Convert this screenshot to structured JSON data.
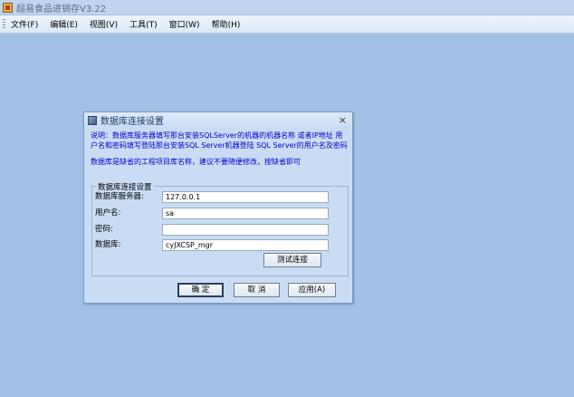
{
  "window": {
    "title": "超易食品进销存V3.22"
  },
  "menu": [
    "文件(F)",
    "编辑(E)",
    "视图(V)",
    "工具(T)",
    "窗口(W)",
    "帮助(H)"
  ],
  "dialog": {
    "title": "数据库连接设置",
    "close": "×",
    "description": "说明：数据库服务器填写那台安装SQLServer的机器的机器名称 或者IP地址 用户名和密码填写登陆那台安装SQL Server机器登陆 SQL Server的用户名及密码",
    "note": "数据库是缺省的工程项目库名称，建议不要随便修改，按缺省即可",
    "group_label": "数据库连接设置",
    "fields": {
      "server": {
        "label": "数据库服务器:",
        "value": "127.0.0.1"
      },
      "user": {
        "label": "用户名:",
        "value": "sa"
      },
      "password": {
        "label": "密码:",
        "value": ""
      },
      "database": {
        "label": "数据库:",
        "value": "cyJXCSP_mgr"
      }
    },
    "buttons": {
      "test": "测试连接",
      "ok": "确 定",
      "cancel": "取 消",
      "apply": "应用(A)"
    }
  },
  "colors": {
    "desktop": "#a3c0e6",
    "dialog": "#c9dcf4",
    "description_text": "#0000cc"
  }
}
